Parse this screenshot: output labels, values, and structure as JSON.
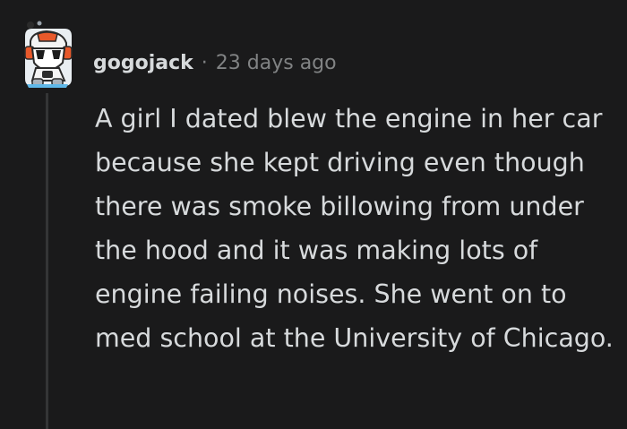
{
  "comment": {
    "author": "gogojack",
    "separator": "·",
    "timestamp": "23 days ago",
    "avatar_icon": "robot-avatar-icon",
    "body": "A girl I dated blew the engine in her car because she kept driving even though there was smoke billowing from under the hood and it was making lots of engine failing noises. She went on to med school at the University of Chicago."
  },
  "colors": {
    "background": "#1a1a1b",
    "text": "#d7dadc",
    "meta": "#818384",
    "thread_line": "#343536",
    "avatar_accent": "#e8592b"
  }
}
